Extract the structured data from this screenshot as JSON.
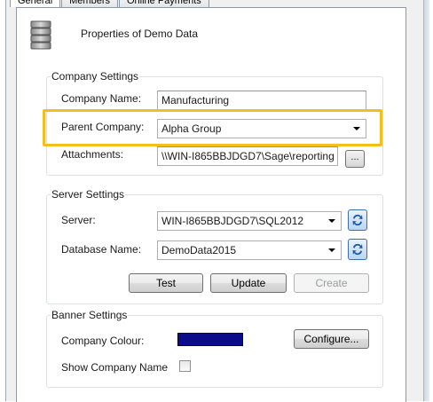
{
  "tabs": [
    {
      "label": "General"
    },
    {
      "label": "Members"
    },
    {
      "label": "Online Payments"
    }
  ],
  "header": {
    "title": "Properties of Demo Data",
    "icon": "database-icon"
  },
  "company_settings": {
    "legend": "Company Settings",
    "company_name_label": "Company Name:",
    "company_name_value": "Manufacturing",
    "parent_company_label": "Parent Company:",
    "parent_company_value": "Alpha Group",
    "attachments_label": "Attachments:",
    "attachments_value": "\\\\WIN-I865BBJDGD7\\Sage\\reporting",
    "browse_label": "..."
  },
  "server_settings": {
    "legend": "Server Settings",
    "server_label": "Server:",
    "server_value": "WIN-I865BBJDGD7\\SQL2012",
    "database_label": "Database Name:",
    "database_value": "DemoData2015",
    "test_label": "Test",
    "update_label": "Update",
    "create_label": "Create"
  },
  "banner_settings": {
    "legend": "Banner Settings",
    "colour_label": "Company Colour:",
    "colour_value": "#0c0c8a",
    "configure_label": "Configure...",
    "show_name_label": "Show Company Name",
    "show_name_checked": false
  },
  "highlight_color": "#f2bf1f"
}
